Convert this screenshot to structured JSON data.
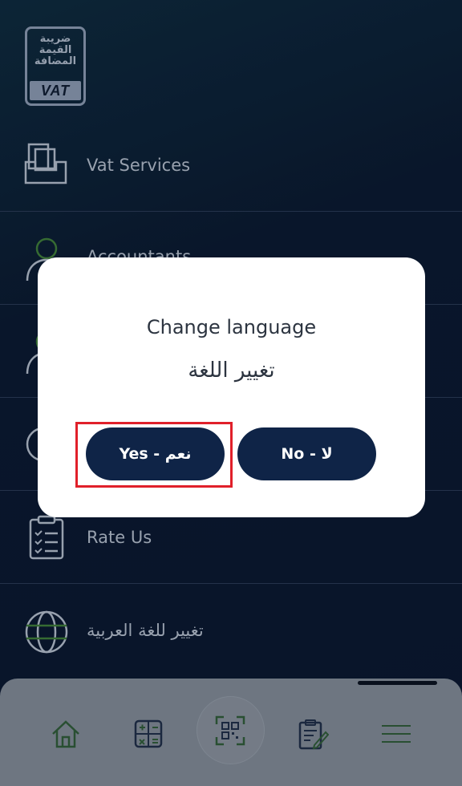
{
  "logo": {
    "arabic_lines": [
      "ضريبة",
      "القيمة",
      "المضافة"
    ],
    "vat_text": "VAT"
  },
  "menu": {
    "items": [
      {
        "label": "Vat Services",
        "icon": "inbox-tray-icon"
      },
      {
        "label": "Accountants",
        "icon": "person-icon"
      },
      {
        "label": "",
        "icon": "person-icon"
      },
      {
        "label": "",
        "icon": "circle-icon"
      },
      {
        "label": "Rate Us",
        "icon": "clipboard-checklist-icon"
      },
      {
        "label": "تغيير للغة العربية",
        "icon": "globe-icon"
      }
    ]
  },
  "dialog": {
    "title": "Change language",
    "title_ar": "تغيير اللغة",
    "yes_label": "Yes - نعم",
    "no_label": "No - لا"
  },
  "bottom_nav": {
    "items": [
      {
        "icon": "home-icon"
      },
      {
        "icon": "calculator-icon"
      },
      {
        "icon": "qr-scan-icon"
      },
      {
        "icon": "clipboard-edit-icon"
      },
      {
        "icon": "hamburger-menu-icon"
      }
    ]
  },
  "colors": {
    "background": "#0b1730",
    "dialog_button": "#0f2447",
    "highlight": "#e0202a",
    "accent_green": "#3e7a3a"
  }
}
